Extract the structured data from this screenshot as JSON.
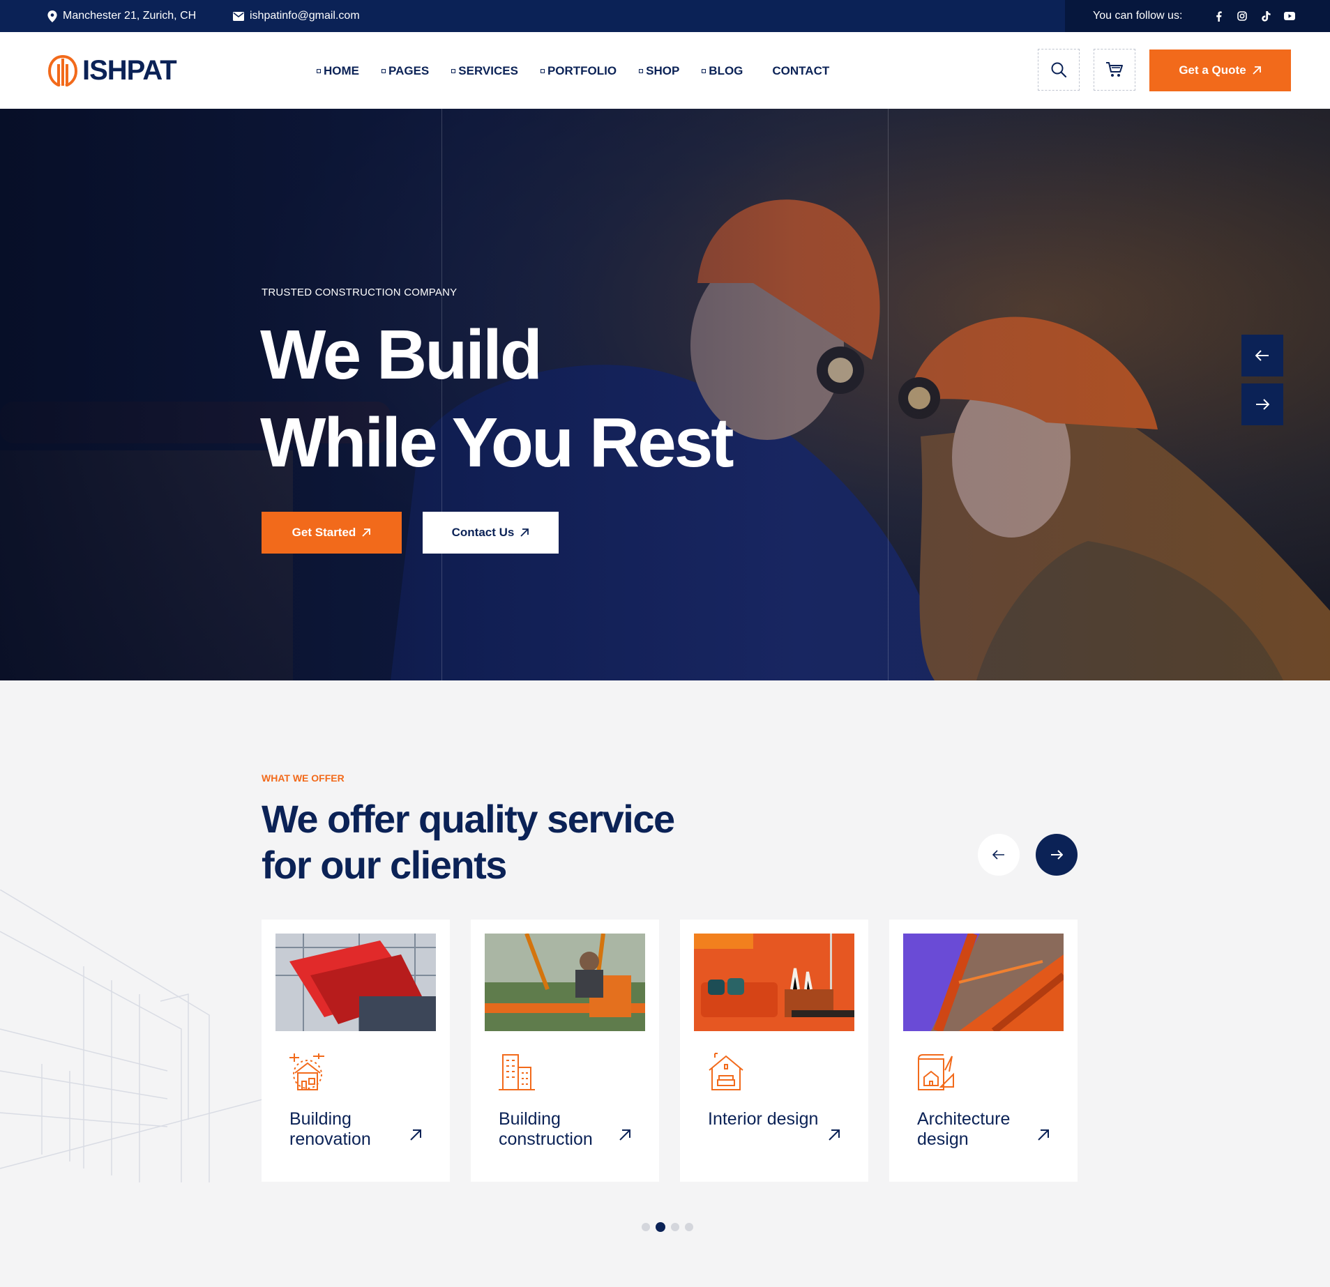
{
  "topbar": {
    "address": "Manchester 21, Zurich, CH",
    "email": "ishpatinfo@gmail.com",
    "follow_label": "You can follow us:",
    "socials": [
      "facebook-icon",
      "instagram-icon",
      "tiktok-icon",
      "youtube-icon"
    ]
  },
  "header": {
    "logo": "ISHPAT",
    "nav": [
      "HOME",
      "PAGES",
      "SERVICES",
      "PORTFOLIO",
      "SHOP",
      "BLOG",
      "CONTACT"
    ],
    "quote_label": "Get a Quote"
  },
  "hero": {
    "eyebrow": "TRUSTED CONSTRUCTION COMPANY",
    "line1": "We Build",
    "line2": "While You Rest",
    "btn_primary": "Get Started",
    "btn_secondary": "Contact Us"
  },
  "services": {
    "eyebrow": "WHAT WE OFFER",
    "title_line1": "We offer quality service",
    "title_line2": "for our clients",
    "cards": [
      {
        "title": "Building renovation",
        "icon": "house-renovation-icon"
      },
      {
        "title": "Building construction",
        "icon": "buildings-icon"
      },
      {
        "title": "Interior design",
        "icon": "interior-house-icon"
      },
      {
        "title": "Architecture design",
        "icon": "blueprint-icon"
      }
    ],
    "pagination": {
      "total": 4,
      "active": 2
    }
  },
  "colors": {
    "navy": "#0b2256",
    "orange": "#f26a1b",
    "background": "#f4f4f5"
  }
}
